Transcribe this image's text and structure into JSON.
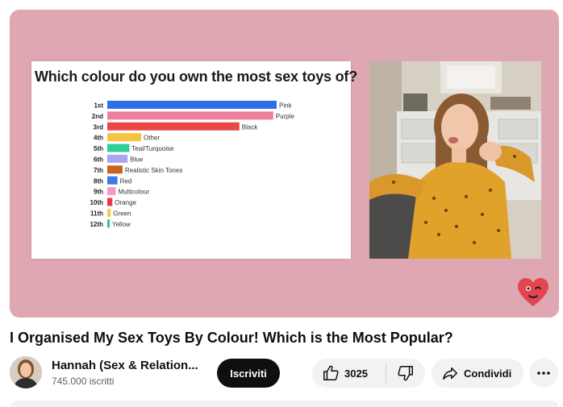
{
  "video": {
    "slide": {
      "title": "Which colour do you own the most sex toys of?",
      "chart_data": {
        "type": "bar",
        "orientation": "horizontal",
        "title": "Which colour do you own the most sex toys of?",
        "categories": [
          "1st",
          "2nd",
          "3rd",
          "4th",
          "5th",
          "6th",
          "7th",
          "8th",
          "9th",
          "10th",
          "11th",
          "12th"
        ],
        "labels": [
          "Pink",
          "Purple",
          "Black",
          "Other",
          "Teal/Turquoise",
          "Blue",
          "Realistic Skin Tones",
          "Red",
          "Multicolour",
          "Orange",
          "Green",
          "Yellow"
        ],
        "values": [
          100,
          98,
          78,
          20,
          13,
          12,
          9,
          6,
          5,
          3,
          2,
          1
        ],
        "colors": [
          "#2e6fe6",
          "#ee7f9d",
          "#e84848",
          "#f7c442",
          "#2dcf96",
          "#a9a5ef",
          "#c9651a",
          "#3b7ae8",
          "#f49ac2",
          "#e8394a",
          "#f5cf4a",
          "#2ac48d"
        ],
        "grid": false,
        "legend": "none"
      }
    },
    "title": "I Organised My Sex Toys By Colour! Which is the Most Popular?"
  },
  "channel": {
    "name": "Hannah (Sex & Relation...",
    "subscribers": "745.000 iscritti"
  },
  "actions": {
    "subscribe_label": "Iscriviti",
    "like_count": "3025",
    "share_label": "Condividi"
  },
  "icons": {
    "like": "thumbs-up-icon",
    "dislike": "thumbs-down-icon",
    "share": "share-arrow-icon",
    "more": "more-dots-icon",
    "heart": "heart-wink-icon"
  },
  "colors": {
    "player_background": "#dea7b2",
    "subscribe_bg": "#0f0f0f",
    "button_bg": "#f2f2f2",
    "heart": "#e24550"
  }
}
